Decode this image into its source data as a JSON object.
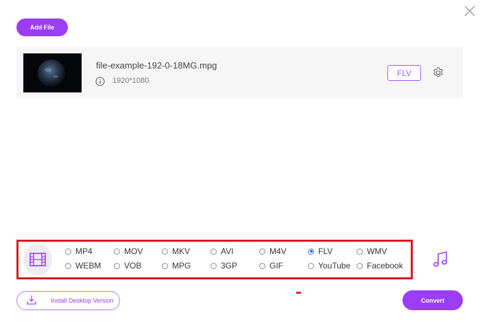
{
  "toolbar": {
    "add_file_label": "Add File"
  },
  "file": {
    "name": "file-example-192-0-18MG.mpg",
    "resolution": "1920*1080",
    "output_format": "FLV"
  },
  "formats": {
    "selected": "FLV",
    "options": [
      {
        "label": "MP4",
        "checked": false
      },
      {
        "label": "MOV",
        "checked": false
      },
      {
        "label": "MKV",
        "checked": false
      },
      {
        "label": "AVI",
        "checked": false
      },
      {
        "label": "M4V",
        "checked": false
      },
      {
        "label": "FLV",
        "checked": true
      },
      {
        "label": "WMV",
        "checked": false
      },
      {
        "label": "WEBM",
        "checked": false
      },
      {
        "label": "VOB",
        "checked": false
      },
      {
        "label": "MPG",
        "checked": false
      },
      {
        "label": "3GP",
        "checked": false
      },
      {
        "label": "GIF",
        "checked": false
      },
      {
        "label": "YouTube",
        "checked": false
      },
      {
        "label": "Facebook",
        "checked": false
      }
    ]
  },
  "footer": {
    "install_label": "Install Desktop Version",
    "convert_label": "Convert"
  },
  "icons": {
    "close": "close-icon",
    "info": "info-icon",
    "settings": "gear-icon",
    "video_tab": "film-icon",
    "audio_tab": "music-note-icon",
    "download": "download-icon"
  },
  "colors": {
    "accent": "#9b3df5",
    "accent_light": "#a259f7",
    "highlight_border": "#d71920",
    "radio_checked": "#2f62e6",
    "file_row_bg": "#f6f6f6"
  }
}
